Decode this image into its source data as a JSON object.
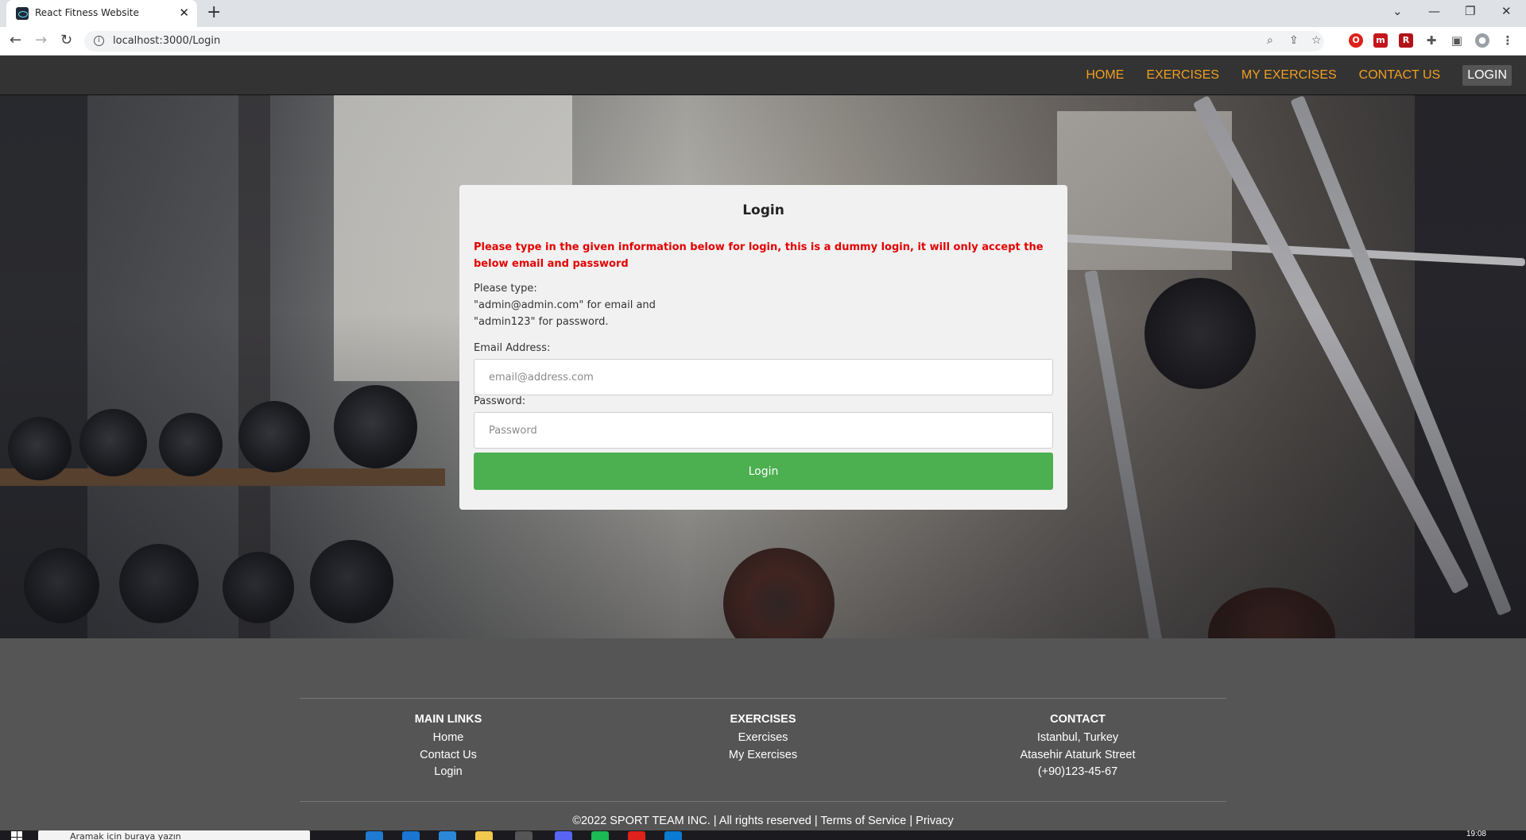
{
  "browser": {
    "tab_title": "React Fitness Website",
    "url": "localhost:3000/Login",
    "close_tab": "✕",
    "new_tab": "+",
    "window_controls": [
      "⌄",
      "—",
      "❐",
      "✕"
    ]
  },
  "nav": {
    "links": [
      "HOME",
      "EXERCISES",
      "MY EXERCISES",
      "CONTACT US",
      "LOGIN"
    ],
    "active": "LOGIN",
    "link_color": "#f0a020"
  },
  "login": {
    "title": "Login",
    "warning": "Please type in the given information below for login, this is a dummy login, it will only accept the below email and password",
    "hint_line1": "Please type:",
    "hint_line2": "\"admin@admin.com\" for email and",
    "hint_line3": "\"admin123\" for password.",
    "email_label": "Email Address:",
    "email_placeholder": "email@address.com",
    "password_label": "Password:",
    "password_placeholder": "Password",
    "button_label": "Login",
    "button_color": "#4caf50",
    "warning_color": "#e30000"
  },
  "footer": {
    "columns": [
      {
        "heading": "MAIN LINKS",
        "items": [
          "Home",
          "Contact Us",
          "Login"
        ]
      },
      {
        "heading": "EXERCISES",
        "items": [
          "Exercises",
          "My Exercises"
        ]
      },
      {
        "heading": "CONTACT",
        "items": [
          "Istanbul, Turkey",
          "Atasehir Ataturk Street",
          "(+90)123-45-67"
        ]
      }
    ],
    "copyright": "©2022 SPORT TEAM INC. | All rights reserved | Terms of Service | Privacy"
  },
  "taskbar": {
    "search_placeholder": "Aramak için buraya yazın",
    "time": "19:08"
  }
}
